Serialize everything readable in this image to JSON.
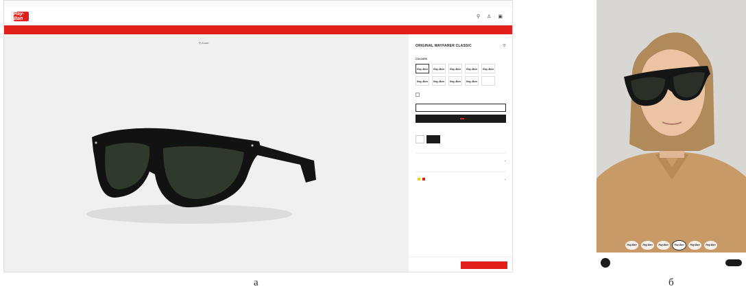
{
  "panel_a": {
    "topbar": {
      "left": "",
      "right": ""
    },
    "logo": "Ray-Ban",
    "nav": {
      "links": [
        "",
        "",
        "",
        "",
        "",
        "",
        "",
        ""
      ]
    },
    "promo": "",
    "zoom_label": "Zoom",
    "product": {
      "title": "ORIGINAL WAYFARER CLASSIC",
      "color_label": "COLOURS",
      "swatch_labels": [
        "Ray-Ban",
        "Ray-Ban",
        "Ray-Ban",
        "Ray-Ban",
        "Ray-Ban",
        "Ray-Ban",
        "Ray-Ban",
        "Ray-Ban",
        "Ray-Ban",
        ""
      ],
      "frame_line": "",
      "lens_line": "",
      "polarized_label": "",
      "polarized_link": "",
      "outline_button": "",
      "dark_button": "",
      "dark_button_tag": "",
      "size_label": "",
      "size_guide": "",
      "sizes": [
        "",
        ""
      ],
      "sections": [
        {
          "label": "",
          "tags": []
        },
        {
          "label": "",
          "tags": [
            "",
            ""
          ]
        }
      ],
      "note": "",
      "extra_row": {
        "label": "",
        "value": ""
      },
      "price": "",
      "add_to_cart": ""
    }
  },
  "panel_b": {
    "thumbs": [
      "Ray-Ban",
      "Ray-Ban",
      "Ray-Ban",
      "Ray-Ban",
      "Ray-Ban",
      "Ray-Ban"
    ],
    "product_name": "",
    "product_sub": "",
    "right_button": ""
  },
  "captions": {
    "a": "а",
    "b": "б"
  },
  "colors": {
    "brand_red": "#e1201b",
    "dark": "#1b1b1b",
    "lens_green": "#2f3a2c",
    "shirt": "#c79a68"
  }
}
